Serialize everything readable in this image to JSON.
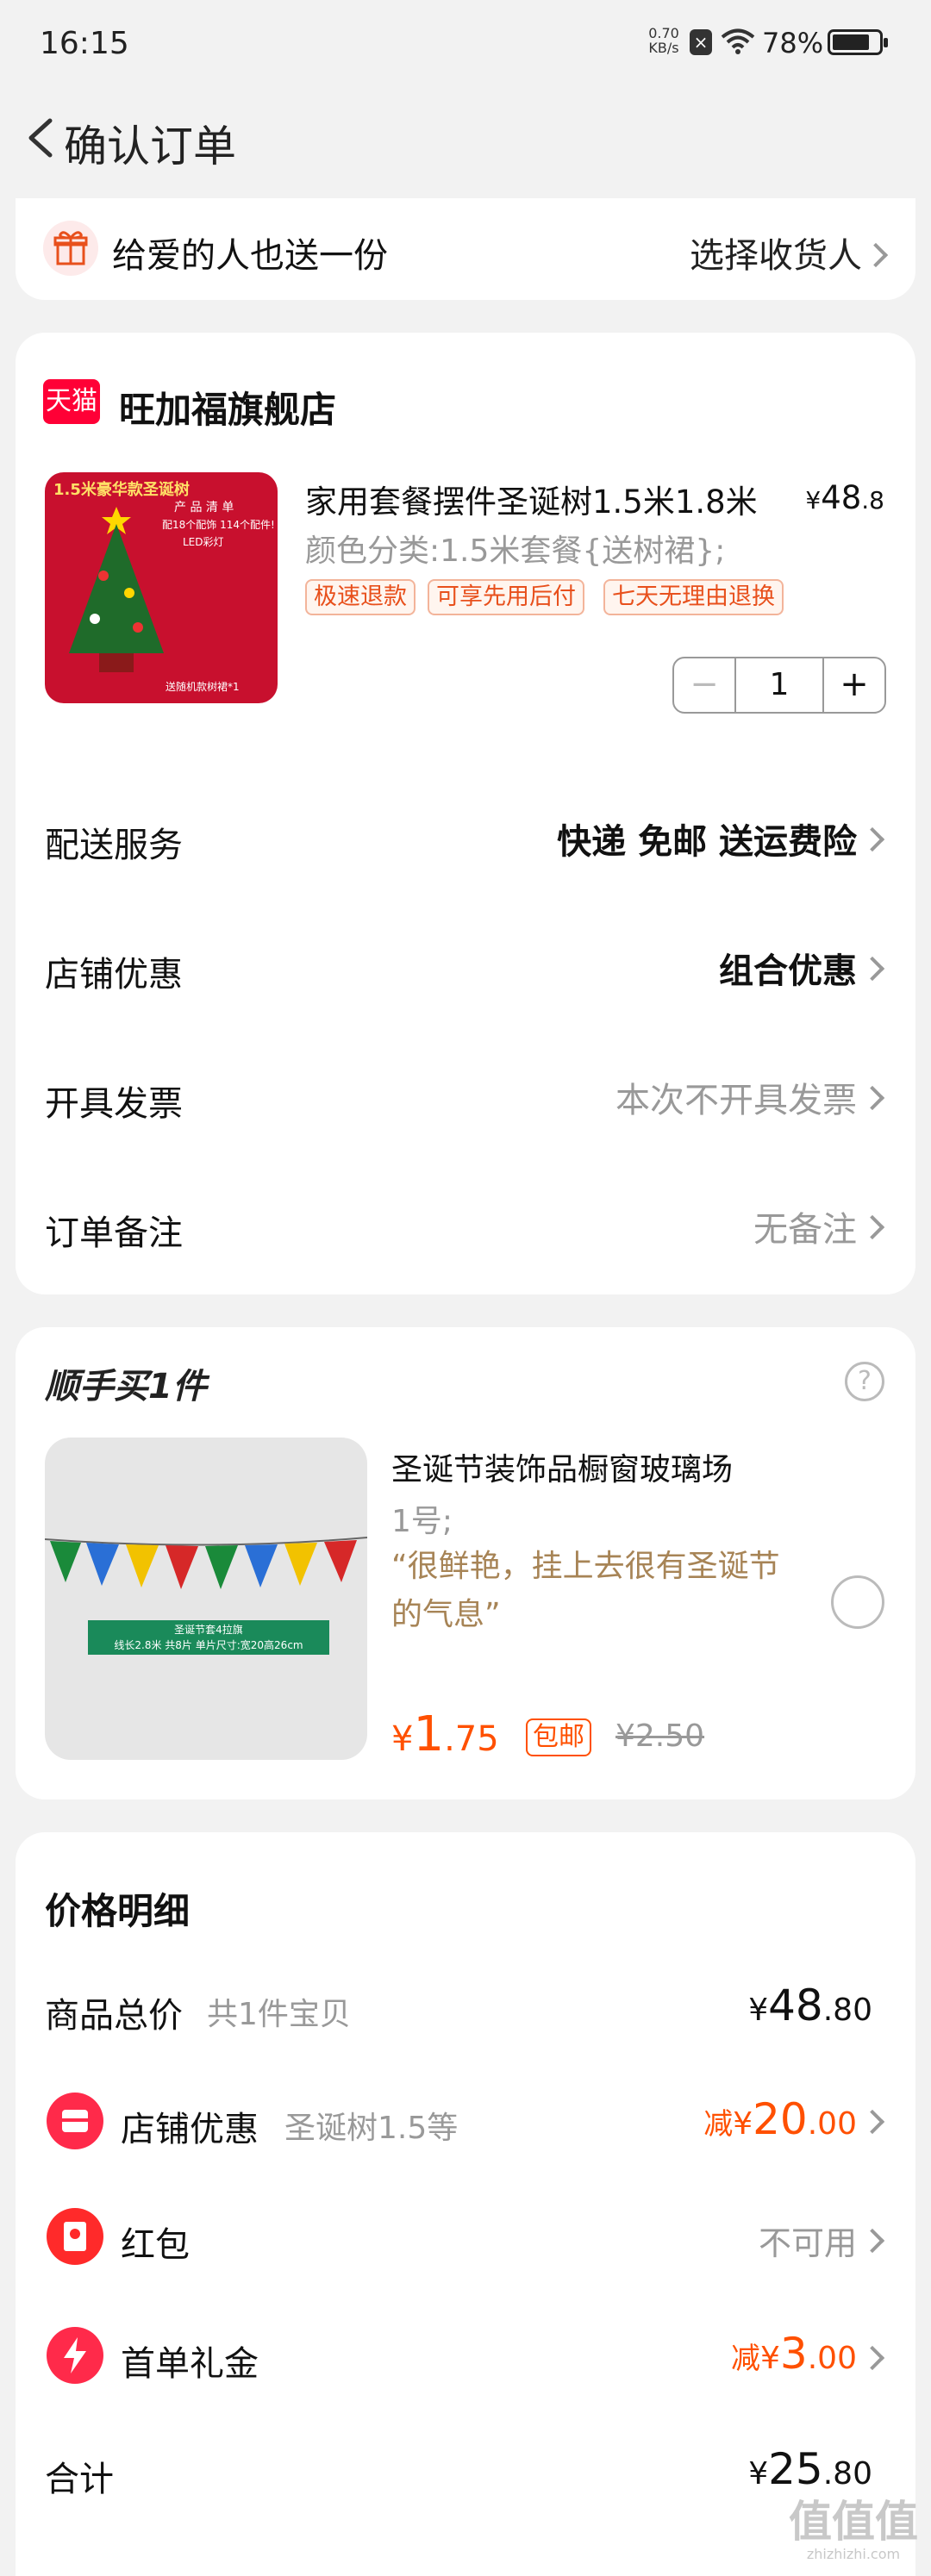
{
  "status": {
    "time": "16:15",
    "speed_value": "0.70",
    "speed_unit": "KB/s",
    "battery": "78%"
  },
  "header": {
    "title": "确认订单"
  },
  "gift": {
    "label": "给爱的人也送一份",
    "action": "选择收货人"
  },
  "shop": {
    "badge": "天猫",
    "name": "旺加福旗舰店",
    "product": {
      "title": "家用套餐摆件圣诞树1.5米1.8米",
      "price_symbol": "¥",
      "price_int": "48",
      "price_dec": ".8",
      "variant": "颜色分类:1.5米套餐{送树裙};",
      "tags": [
        "极速退款",
        "可享先用后付",
        "七天无理由退换"
      ],
      "quantity": "1",
      "minus": "−",
      "plus": "+",
      "image_lines": [
        "1.5米豪华款圣诞树",
        "产 品 清 单",
        "配18个配饰 114个配件!",
        "LED彩灯",
        "送随机款树裙*1"
      ]
    },
    "rows": [
      {
        "label": "配送服务",
        "value": "快递 免邮 送运费险"
      },
      {
        "label": "店铺优惠",
        "value": "组合优惠"
      },
      {
        "label": "开具发票",
        "value": "本次不开具发票"
      },
      {
        "label": "订单备注",
        "value": "无备注"
      }
    ]
  },
  "addon": {
    "heading": "顺手买1件",
    "help_icon": "?",
    "title": "圣诞节装饰品橱窗玻璃场",
    "spec": "1号;",
    "review": "“很鲜艳，挂上去很有圣诞节的气息”",
    "price_symbol": "¥",
    "price_int": "1",
    "price_dec": ".75",
    "shipping_badge": "包邮",
    "original_price": "¥2.50",
    "image_lines": [
      "圣诞节套4拉旗",
      "线长2.8米 共8片 单片尺寸:宽20高26cm"
    ]
  },
  "price_detail": {
    "heading": "价格明细",
    "goods_total_label": "商品总价",
    "goods_total_sub": "共1件宝贝",
    "goods_total_symbol": "¥",
    "goods_total_int": "48",
    "goods_total_dec": ".80",
    "shop_discount_label": "店铺优惠",
    "shop_discount_sub": "圣诞树1.5等",
    "shop_discount_prefix": "减",
    "shop_discount_symbol": "¥",
    "shop_discount_int": "20",
    "shop_discount_dec": ".00",
    "redpacket_label": "红包",
    "redpacket_value": "不可用",
    "firstorder_label": "首单礼金",
    "firstorder_prefix": "减",
    "firstorder_symbol": "¥",
    "firstorder_int": "3",
    "firstorder_dec": ".00",
    "total_label": "合计",
    "total_symbol": "¥",
    "total_int": "25",
    "total_dec": ".80"
  },
  "watermark": {
    "text": "值值值",
    "sub": "zhizhizhi.com"
  },
  "colors": {
    "accent": "#ff5000",
    "tmall_red": "#ff0036",
    "background": "#f2f2f2"
  }
}
